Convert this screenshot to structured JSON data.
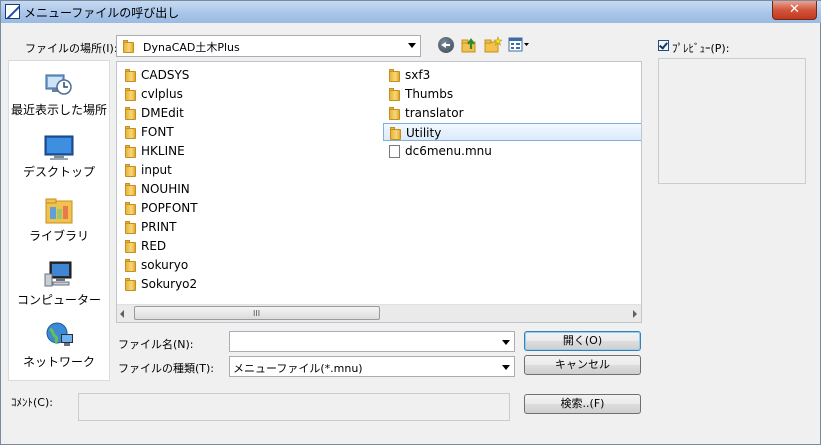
{
  "window": {
    "title": "メニューファイルの呼び出し",
    "close_label": "✕"
  },
  "toolbar": {
    "lookin_label": "ファイルの場所(I):",
    "lookin_value": "DynaCAD土木Plus",
    "back_icon": "back-arrow-icon",
    "up_icon": "up-folder-icon",
    "new_folder_icon": "new-folder-icon",
    "view_icon": "view-menu-icon"
  },
  "places": [
    {
      "label": "最近表示した場所",
      "icon": "recent-places-icon"
    },
    {
      "label": "デスクトップ",
      "icon": "desktop-icon"
    },
    {
      "label": "ライブラリ",
      "icon": "libraries-icon"
    },
    {
      "label": "コンピューター",
      "icon": "computer-icon"
    },
    {
      "label": "ネットワーク",
      "icon": "network-icon"
    }
  ],
  "files": {
    "column1": [
      {
        "name": "CADSYS",
        "type": "folder"
      },
      {
        "name": "cvlplus",
        "type": "folder"
      },
      {
        "name": "DMEdit",
        "type": "folder"
      },
      {
        "name": "FONT",
        "type": "folder"
      },
      {
        "name": "HKLINE",
        "type": "folder"
      },
      {
        "name": "input",
        "type": "folder"
      },
      {
        "name": "NOUHIN",
        "type": "folder"
      },
      {
        "name": "POPFONT",
        "type": "folder"
      },
      {
        "name": "PRINT",
        "type": "folder"
      },
      {
        "name": "RED",
        "type": "folder"
      },
      {
        "name": "sokuryo",
        "type": "folder"
      },
      {
        "name": "Sokuryo2",
        "type": "folder"
      }
    ],
    "column2": [
      {
        "name": "sxf3",
        "type": "folder"
      },
      {
        "name": "Thumbs",
        "type": "folder"
      },
      {
        "name": "translator",
        "type": "folder"
      },
      {
        "name": "Utility",
        "type": "folder",
        "selected": true
      },
      {
        "name": "dc6menu.mnu",
        "type": "file"
      }
    ],
    "scroll_grip": "III"
  },
  "form": {
    "filename_label": "ファイル名(N):",
    "filename_value": "",
    "filetype_label": "ファイルの種類(T):",
    "filetype_value": "メニューファイル(*.mnu)",
    "comment_label": "ｺﾒﾝﾄ(C):",
    "comment_value": ""
  },
  "buttons": {
    "open": "開く(O)",
    "cancel": "キャンセル",
    "search": "検索..(F)"
  },
  "preview": {
    "label": "ﾌﾟﾚﾋﾞｭｰ(P):",
    "checked": true
  },
  "colors": {
    "selection": "#dbeafb",
    "title_bar": "#a9c5e8",
    "close_button": "#d2553c"
  }
}
